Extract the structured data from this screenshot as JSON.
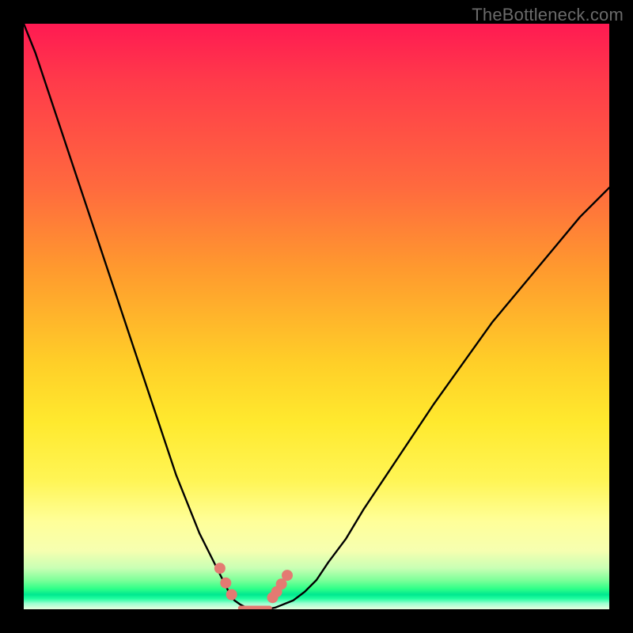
{
  "watermark": "TheBottleneck.com",
  "chart_data": {
    "type": "line",
    "title": "",
    "xlabel": "",
    "ylabel": "",
    "ylim": [
      0,
      100
    ],
    "xlim": [
      0,
      100
    ],
    "x": [
      0,
      2,
      4,
      6,
      8,
      10,
      12,
      14,
      16,
      18,
      20,
      22,
      24,
      26,
      28,
      30,
      32,
      34,
      35,
      36,
      37,
      38,
      39,
      40,
      41,
      42,
      43,
      44,
      46,
      48,
      50,
      52,
      55,
      58,
      62,
      66,
      70,
      75,
      80,
      85,
      90,
      95,
      100
    ],
    "values": [
      100,
      95,
      89,
      83,
      77,
      71,
      65,
      59,
      53,
      47,
      41,
      35,
      29,
      23,
      18,
      13,
      9,
      5,
      3,
      1.5,
      0.8,
      0.3,
      0.1,
      0,
      0,
      0.1,
      0.3,
      0.7,
      1.5,
      3,
      5,
      8,
      12,
      17,
      23,
      29,
      35,
      42,
      49,
      55,
      61,
      67,
      72
    ],
    "markers": {
      "x": [
        33.5,
        34.5,
        35.5,
        42.5,
        43.2,
        44.0,
        45.0
      ],
      "values": [
        7.0,
        4.5,
        2.5,
        2.0,
        3.0,
        4.3,
        5.8
      ]
    },
    "plateau": {
      "x0": 37,
      "x1": 42,
      "y": 0.2
    },
    "marker_color": "#e47a72",
    "curve_color": "#000000"
  }
}
